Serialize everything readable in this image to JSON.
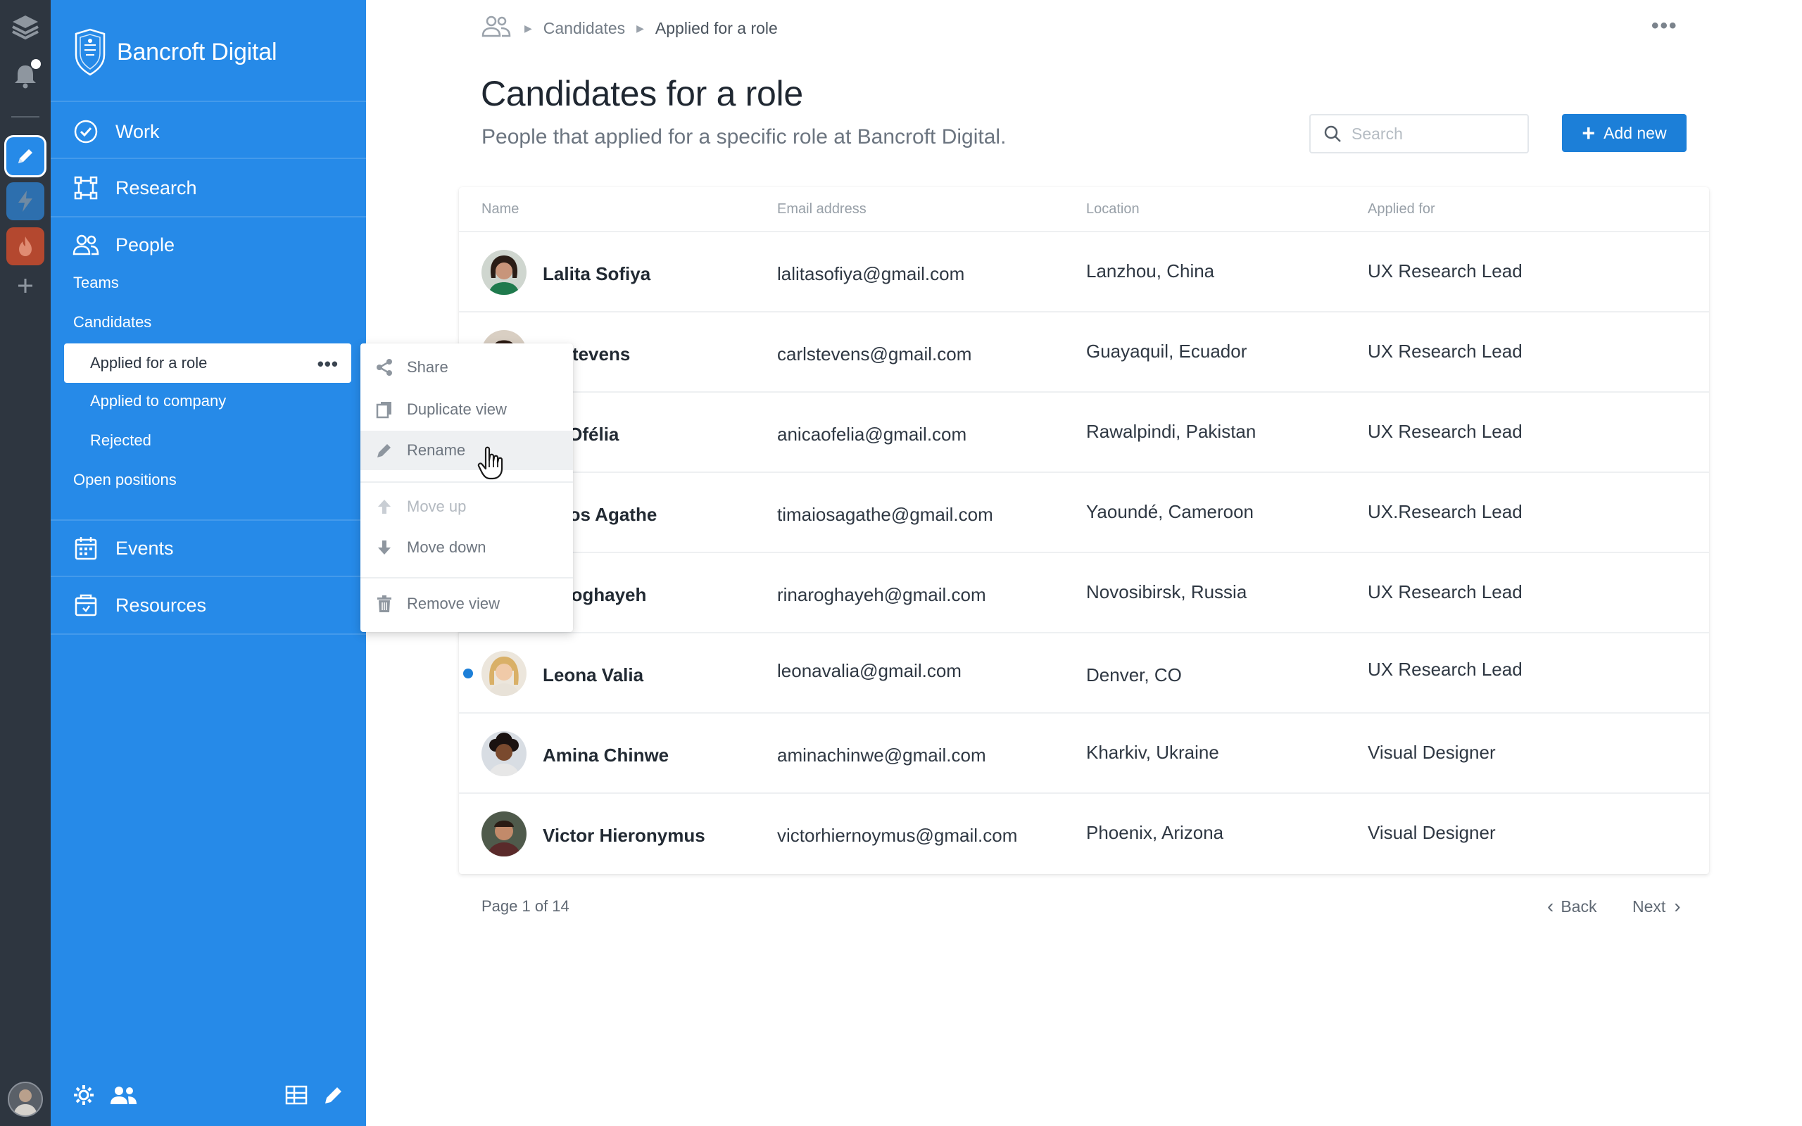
{
  "app": {
    "brand": "Bancroft Digital",
    "accent": "#268ae8",
    "button_blue": "#1c7fd8"
  },
  "rail": {
    "items": [
      "layers-icon",
      "notification-bell-icon",
      "pencil-icon",
      "lightning-icon",
      "flame-icon",
      "plus-icon"
    ]
  },
  "sidebar": {
    "nav": {
      "work": "Work",
      "research": "Research",
      "people": "People",
      "events": "Events",
      "resources": "Resources"
    },
    "people_sub": {
      "teams": "Teams",
      "candidates": "Candidates",
      "applied_role": "Applied for a role",
      "applied_company": "Applied to company",
      "rejected": "Rejected",
      "open_positions": "Open positions"
    }
  },
  "breadcrumb": {
    "items": [
      "Candidates",
      "Applied for a role"
    ]
  },
  "header": {
    "title": "Candidates for a role",
    "subtitle": "People that applied for a specific role at Bancroft Digital.",
    "search_placeholder": "Search",
    "add_label": "Add new"
  },
  "table": {
    "columns": [
      "Name",
      "Email address",
      "Location",
      "Applied for"
    ],
    "rows": [
      {
        "name": "Lalita Sofiya",
        "email": "lalitasofiya@gmail.com",
        "location": "Lanzhou, China",
        "role": "UX Research Lead"
      },
      {
        "name": "rl Stevens",
        "email": "carlstevens@gmail.com",
        "location": "Guayaquil, Ecuador",
        "role": "UX Research Lead"
      },
      {
        "name": "ca Ofélia",
        "email": "anicaofelia@gmail.com",
        "location": "Rawalpindi, Pakistan",
        "role": "UX Research Lead"
      },
      {
        "name": "naios Agathe",
        "email": "timaiosagathe@gmail.com",
        "location": "Yaoundé, Cameroon",
        "role": "UX.Research Lead"
      },
      {
        "name": "a Roghayeh",
        "email": "rinaroghayeh@gmail.com",
        "location": "Novosibirsk, Russia",
        "role": "UX Research Lead"
      },
      {
        "name": "Leona Valia",
        "email": "leonavalia@gmail.com",
        "location": "Denver, CO",
        "role": "UX Research Lead"
      },
      {
        "name": "Amina Chinwe",
        "email": "aminachinwe@gmail.com",
        "location": "Kharkiv, Ukraine",
        "role": "Visual Designer"
      },
      {
        "name": "Victor Hieronymus",
        "email": "victorhiernoymus@gmail.com",
        "location": "Phoenix, Arizona",
        "role": "Visual Designer"
      }
    ]
  },
  "pagination": {
    "text": "Page 1 of 14",
    "back": "Back",
    "next": "Next"
  },
  "context_menu": {
    "share": "Share",
    "duplicate": "Duplicate view",
    "rename": "Rename",
    "move_up": "Move up",
    "move_down": "Move down",
    "remove": "Remove view"
  }
}
